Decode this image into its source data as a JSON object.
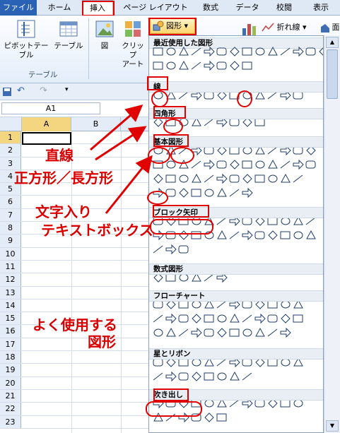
{
  "tabs": [
    "ファイル",
    "ホーム",
    "挿入",
    "ページ レイアウト",
    "数式",
    "データ",
    "校閲",
    "表示"
  ],
  "ribbon": {
    "pivot_label": "ピボットテーブル",
    "table_label": "テーブル",
    "picture_label": "図",
    "clipart_label": "クリップ\nアート",
    "shapes_label": "図形",
    "line_chart_label": "折れ線",
    "area_label": "面",
    "group_label": "テーブル"
  },
  "namebox": "A1",
  "columns": [
    "A",
    "B"
  ],
  "rows": [
    "1",
    "2",
    "3",
    "4",
    "5",
    "6",
    "7",
    "8",
    "9",
    "10",
    "11",
    "12",
    "13",
    "14",
    "15",
    "16",
    "17",
    "18",
    "19",
    "20",
    "21",
    "22",
    "23"
  ],
  "categories": {
    "recent": "最近使用した図形",
    "lines": "線",
    "rect": "四角形",
    "basic": "基本図形",
    "block": "ブロック矢印",
    "equation": "数式図形",
    "flowchart": "フローチャート",
    "stars": "星とリボン",
    "callouts": "吹き出し"
  },
  "annotations": {
    "line": "直線",
    "rect": "正方形／長方形",
    "textbox1": "文字入り",
    "textbox2": "テキストボックス",
    "frequent1": "よく使用する",
    "frequent2": "図形"
  },
  "colors": {
    "accent": "#2a62b5",
    "annotation": "#e00000"
  }
}
